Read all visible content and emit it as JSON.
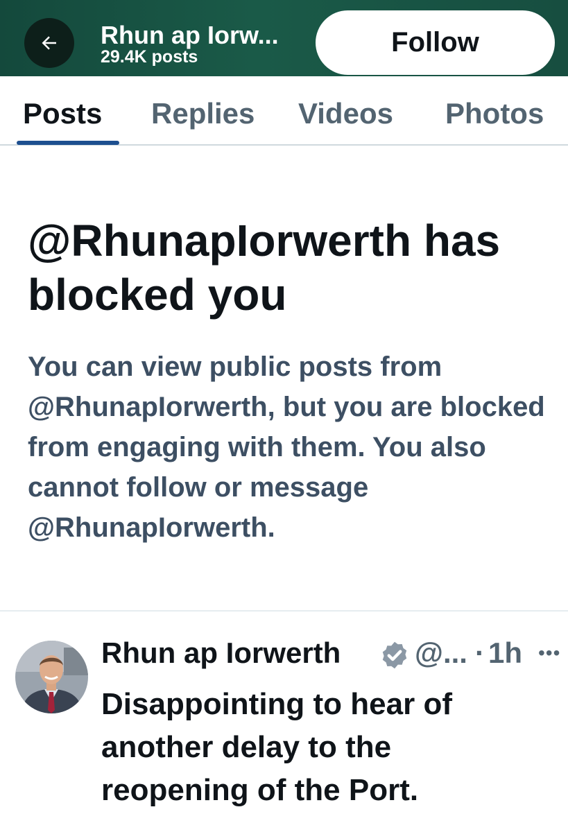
{
  "header": {
    "title": "Rhun ap Iorw...",
    "subtitle": "29.4K posts",
    "follow_label": "Follow"
  },
  "tabs": [
    {
      "label": "Posts",
      "active": true
    },
    {
      "label": "Replies",
      "active": false
    },
    {
      "label": "Videos",
      "active": false
    },
    {
      "label": "Photos",
      "active": false
    }
  ],
  "blocked": {
    "title": "@RhunapIorwerth has blocked you",
    "body": "You can view public posts from @RhunapIorwerth, but you are blocked from engaging with them. You also cannot follow or message @RhunapIorwerth."
  },
  "post": {
    "author_name": "Rhun ap Iorwerth",
    "handle": "@...",
    "separator": "·",
    "time": "1h",
    "text": "Disappointing to hear of another delay to the reopening of the Port.",
    "icons": [
      "back-arrow-icon",
      "verified-badge-icon",
      "more-options-icon"
    ]
  },
  "colors": {
    "header_bg": "#174e40",
    "tab_underline": "#1d4f8f",
    "secondary_text": "#536471",
    "body_muted": "#3d4f63",
    "verified_badge": "#8b98a5"
  }
}
